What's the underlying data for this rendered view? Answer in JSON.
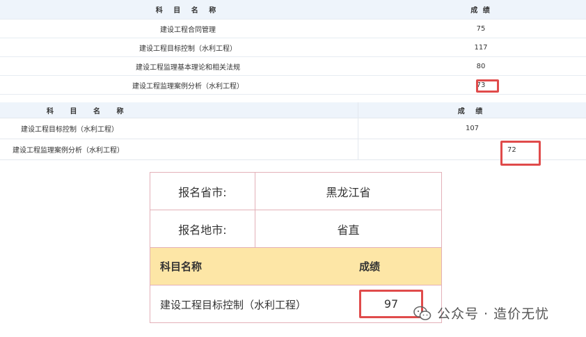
{
  "table1": {
    "header": {
      "subject": "科 目 名 称",
      "score": "成 绩"
    },
    "rows": [
      {
        "subject": "建设工程合同管理",
        "score": "75"
      },
      {
        "subject": "建设工程目标控制（水利工程）",
        "score": "117"
      },
      {
        "subject": "建设工程监理基本理论和相关法规",
        "score": "80"
      },
      {
        "subject": "建设工程监理案例分析（水利工程）",
        "score": "73"
      }
    ]
  },
  "table2": {
    "header": {
      "subject": "科 目 名 称",
      "score": "成 绩"
    },
    "rows": [
      {
        "subject": "建设工程目标控制（水利工程）",
        "score": "107"
      },
      {
        "subject": "建设工程监理案例分析（水利工程）",
        "score": "72"
      }
    ]
  },
  "table3": {
    "province_label": "报名省市:",
    "province_value": "黑龙江省",
    "city_label": "报名地市:",
    "city_value": "省直",
    "header": {
      "subject": "科目名称",
      "score": "成绩"
    },
    "row": {
      "subject": "建设工程目标控制（水利工程）",
      "score": "97"
    }
  },
  "watermark": {
    "text": "公众号 · 造价无忧",
    "icon": "wechat-icon"
  },
  "colors": {
    "highlight": "#e04b4b",
    "header_yellow": "#fde6a6",
    "header_blue": "#eef4fb"
  }
}
